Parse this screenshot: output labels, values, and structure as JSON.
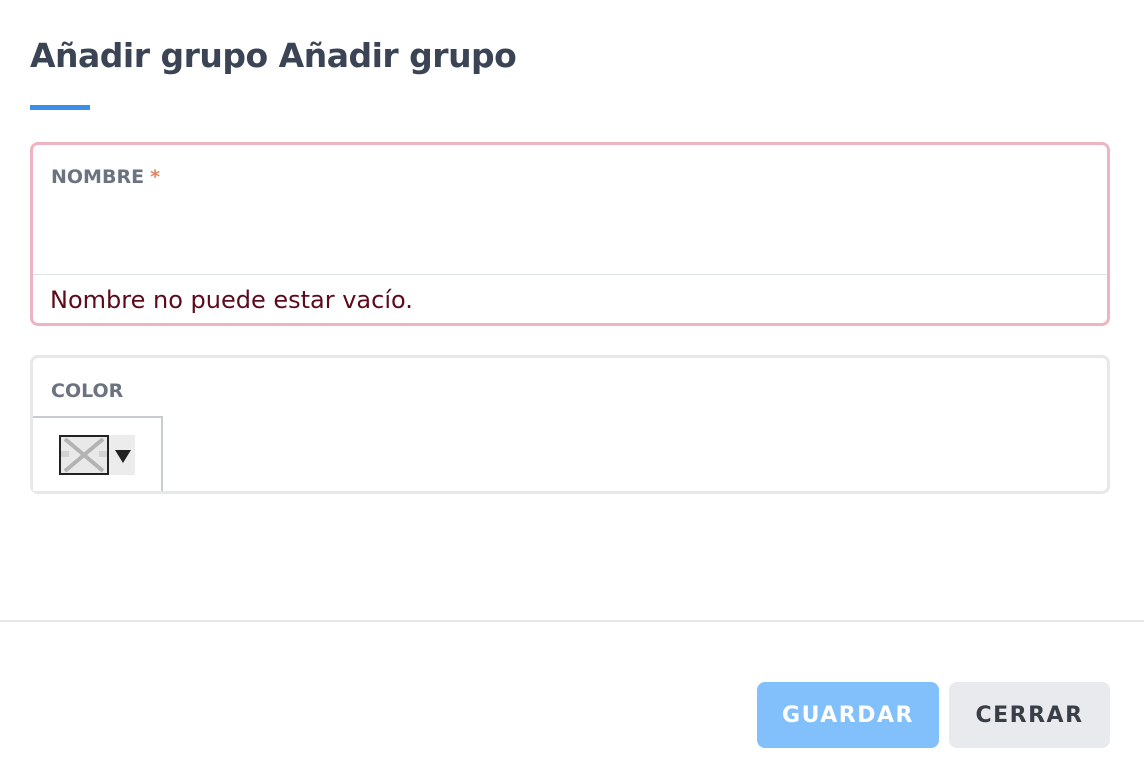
{
  "dialog": {
    "title": "Añadir grupo Añadir grupo",
    "accent_color": "#3b8fe6"
  },
  "fields": {
    "name": {
      "label": "NOMBRE",
      "required_mark": "*",
      "value": "",
      "error": "Nombre no puede estar vacío."
    },
    "color": {
      "label": "COLOR",
      "swatch_icon": "broken-image-icon",
      "dropdown_icon": "triangle-down-icon"
    }
  },
  "footer": {
    "save_label": "GUARDAR",
    "close_label": "CERRAR"
  },
  "colors": {
    "error_border": "#f0b3c0",
    "error_text": "#5c0a1c",
    "primary_button": "#82c0fb",
    "secondary_button": "#e8eaee"
  }
}
